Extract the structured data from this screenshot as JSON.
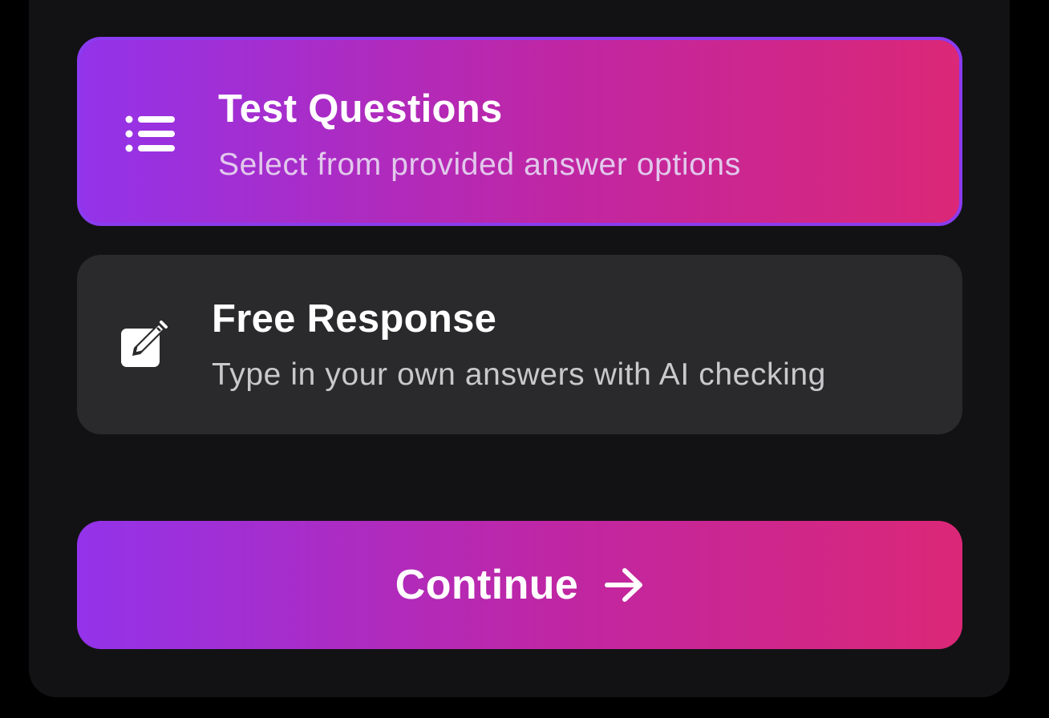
{
  "options": [
    {
      "title": "Test Questions",
      "subtitle": "Select from provided answer options",
      "icon": "list-icon",
      "selected": true
    },
    {
      "title": "Free Response",
      "subtitle": "Type in your own answers with AI checking",
      "icon": "edit-icon",
      "selected": false
    }
  ],
  "continue_button": {
    "label": "Continue",
    "icon": "arrow-right-icon"
  },
  "colors": {
    "background": "#000000",
    "panel": "#121214",
    "gradient_start": "#9333EA",
    "gradient_end": "#DB2777",
    "unselected_card": "#2A2A2C"
  }
}
